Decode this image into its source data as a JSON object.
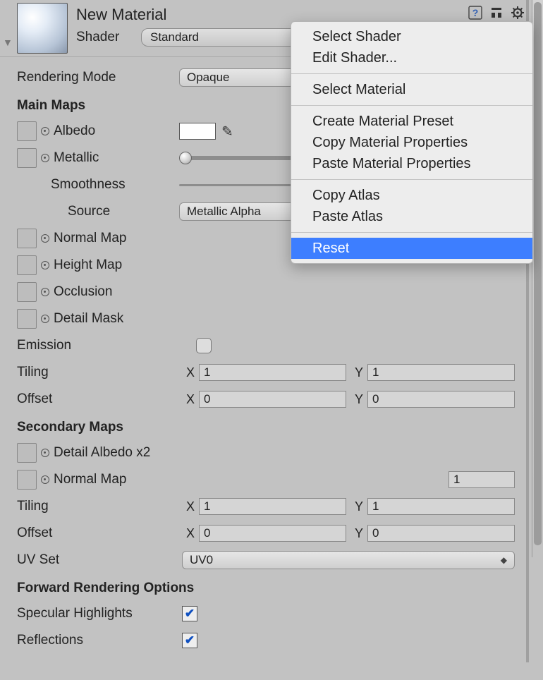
{
  "header": {
    "material_name": "New Material",
    "shader_label": "Shader",
    "shader_value": "Standard"
  },
  "rendering_mode": {
    "label": "Rendering Mode",
    "value": "Opaque"
  },
  "sections": {
    "main_maps": "Main Maps",
    "secondary_maps": "Secondary Maps",
    "forward_rendering": "Forward Rendering Options"
  },
  "labels": {
    "albedo": "Albedo",
    "metallic": "Metallic",
    "smoothness": "Smoothness",
    "source": "Source",
    "source_value": "Metallic Alpha",
    "normal_map": "Normal Map",
    "height_map": "Height Map",
    "occlusion": "Occlusion",
    "detail_mask": "Detail Mask",
    "emission": "Emission",
    "tiling": "Tiling",
    "offset": "Offset",
    "detail_albedo": "Detail Albedo x2",
    "secondary_normal": "Normal Map",
    "secondary_normal_value": "1",
    "uv_set": "UV Set",
    "uv_set_value": "UV0",
    "specular_highlights": "Specular Highlights",
    "reflections": "Reflections"
  },
  "tiling1": {
    "x": "1",
    "y": "1"
  },
  "offset1": {
    "x": "0",
    "y": "0"
  },
  "tiling2": {
    "x": "1",
    "y": "1"
  },
  "offset2": {
    "x": "0",
    "y": "0"
  },
  "axis": {
    "x": "X",
    "y": "Y"
  },
  "context_menu": {
    "select_shader": "Select Shader",
    "edit_shader": "Edit Shader...",
    "select_material": "Select Material",
    "create_preset": "Create Material Preset",
    "copy_props": "Copy Material Properties",
    "paste_props": "Paste Material Properties",
    "copy_atlas": "Copy Atlas",
    "paste_atlas": "Paste Atlas",
    "reset": "Reset"
  }
}
